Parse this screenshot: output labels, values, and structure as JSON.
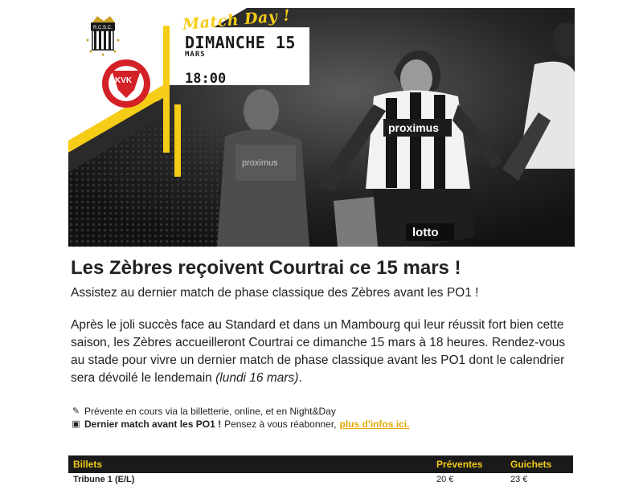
{
  "hero": {
    "matchday_label": "Match Day !",
    "day_label": "DIMANCHE 15",
    "month_label": "MARS",
    "time_label": "18:00",
    "home_crest_text": "R.C.S.C.",
    "away_crest_text": "KVK",
    "jersey_sponsor_center": "proximus",
    "jersey_sponsor_left": "proximus",
    "shorts_sponsor": "lotto",
    "accent_color": "#f5cc16",
    "away_color": "#d42027"
  },
  "article": {
    "title": "Les Zèbres reçoivent Courtrai ce 15 mars !",
    "subtitle": "Assistez au dernier match de phase classique des Zèbres avant les PO1 !",
    "body_main": "Après le joli succès face au Standard et dans un Mambourg qui leur réussit fort bien cette saison, les Zèbres accueilleront Courtrai ce dimanche 15 mars à 18 heures. Rendez-vous au stade pour vivre un dernier match de phase classique avant les PO1 dont le calendrier sera dévoilé le lendemain",
    "body_italic": "(lundi 16 mars)",
    "body_end": "."
  },
  "notes": {
    "presale_icon": "ticket-icon",
    "presale_text": "Prévente en cours via la billetterie, online, et en Night&Day",
    "last_match_icon": "stadium-icon",
    "last_match_bold": "Dernier match avant les PO1 !",
    "last_match_text": "Pensez à vous réabonner,",
    "more_info_link": "plus d'infos ici."
  },
  "prices_table": {
    "headers": [
      "Billets",
      "Préventes",
      "Guichets"
    ],
    "rows": [
      {
        "label": "Tribune 1 (E/L)",
        "presale": "20 €",
        "counter": "23 €"
      }
    ]
  }
}
